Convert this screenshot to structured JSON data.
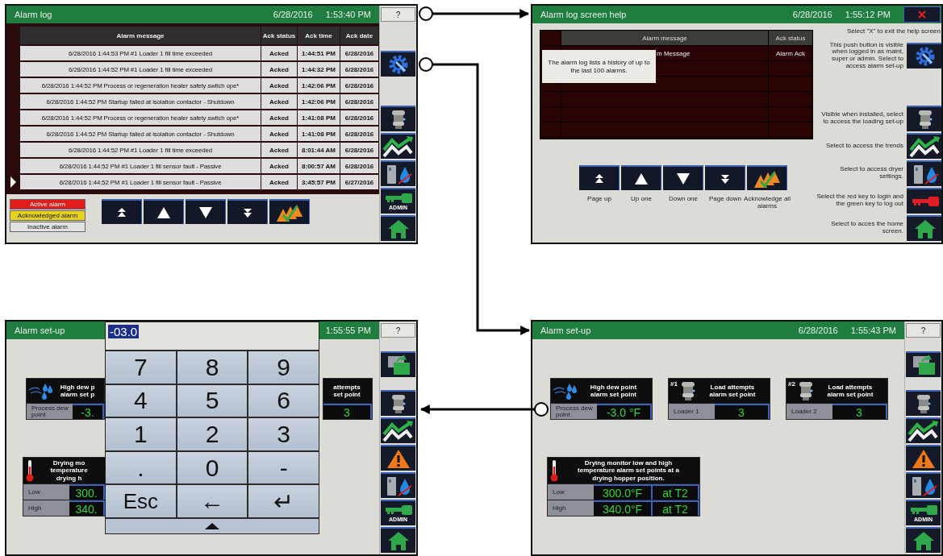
{
  "screens": [
    {
      "kind": "alarm_log",
      "title": "Alarm log",
      "date": "6/28/2016",
      "time": "1:53:40 PM",
      "help_button": "?",
      "table": {
        "columns": [
          "Alarm message",
          "Ack status",
          "Ack time",
          "Ack date"
        ],
        "rows": [
          {
            "cells": [
              "6/28/2016 1:44:53 PM #1 Loader 1 fill time exceeded",
              "Acked",
              "1:44:51 PM",
              "6/28/2016"
            ],
            "selected": false
          },
          {
            "cells": [
              "6/28/2016 1:44:52 PM #1 Loader 1 fill time exceeded",
              "Acked",
              "1:44:32 PM",
              "6/28/2016"
            ],
            "selected": false
          },
          {
            "cells": [
              "6/28/2016 1:44:52 PM Process or regeneration heater safety switch ope*",
              "Acked",
              "1:42:06 PM",
              "6/28/2016"
            ],
            "selected": false
          },
          {
            "cells": [
              "6/28/2016 1:44:52 PM Startup failed at isolation contactor - Shutdown",
              "Acked",
              "1:42:06 PM",
              "6/28/2016"
            ],
            "selected": false
          },
          {
            "cells": [
              "6/28/2016 1:44:52 PM Process or regeneration heater safety switch ope*",
              "Acked",
              "1:41:08 PM",
              "6/28/2016"
            ],
            "selected": false
          },
          {
            "cells": [
              "6/28/2016 1:44:52 PM Startup failed at isolation contactor - Shutdown",
              "Acked",
              "1:41:08 PM",
              "6/28/2016"
            ],
            "selected": false
          },
          {
            "cells": [
              "6/28/2016 1:44:52 PM #1 Loader 1 fill time exceeded",
              "Acked",
              "8:01:44 AM",
              "6/28/2016"
            ],
            "selected": false
          },
          {
            "cells": [
              "6/28/2016 1:44:52 PM #1 Loader 1 fill sensor fault - Passive",
              "Acked",
              "8:00:57 AM",
              "6/28/2016"
            ],
            "selected": false
          },
          {
            "cells": [
              "6/28/2016 1:44:52 PM #1 Loader 1 fill sensor fault - Passive",
              "Acked",
              "3:45:57 PM",
              "6/27/2016"
            ],
            "selected": true
          }
        ]
      },
      "legend": [
        {
          "label": "Active alarm",
          "color": "#e01c1c"
        },
        {
          "label": "Acknowledged alarm",
          "color": "#e6d21c"
        },
        {
          "label": "Inactive alarm",
          "color": "#e2e2e0"
        }
      ],
      "nav_buttons": [
        {
          "kind": "page_up"
        },
        {
          "kind": "up"
        },
        {
          "kind": "down"
        },
        {
          "kind": "page_down"
        },
        {
          "kind": "acknowledge"
        }
      ],
      "sidebar_top": [
        {
          "kind": "gear"
        }
      ],
      "sidebar": [
        {
          "kind": "loader"
        },
        {
          "kind": "trend"
        },
        {
          "kind": "dryer"
        },
        {
          "kind": "green_key",
          "label": "ADMIN"
        },
        {
          "kind": "home"
        }
      ]
    },
    {
      "kind": "help",
      "title": "Alarm log screen help",
      "date": "6/28/2016",
      "time": "1:55:12 PM",
      "table": {
        "columns": [
          "Alarm message",
          "Ack status"
        ],
        "rows": [
          {
            "cells": [
              "m Message",
              "Alarm Ack"
            ]
          }
        ]
      },
      "tooltip": "The alarm log lists a history of up to the last 100 alarms.",
      "nav_buttons": [
        {
          "kind": "page_up",
          "caption": "Page up"
        },
        {
          "kind": "up",
          "caption": "Up one"
        },
        {
          "kind": "down",
          "caption": "Down one"
        },
        {
          "kind": "page_down",
          "caption": "Page down"
        },
        {
          "kind": "acknowledge",
          "caption": "Acknowledge all alarms"
        }
      ],
      "close_hint": "Select \"X\" to exit the help screen",
      "help_items": [
        {
          "kind": "gear",
          "text": "This push button is visible when logged in as maint, super or admin. Select to access alarm set-up"
        },
        {
          "kind": "loader",
          "text": "Visible when installed, select to access the loading set-up"
        },
        {
          "kind": "trend",
          "text": "Select to access the trends"
        },
        {
          "kind": "dryer",
          "text": "Select to access dryer settings."
        },
        {
          "kind": "red_key",
          "text": "Select the red key to login and the green key to log out"
        },
        {
          "kind": "home",
          "text": "Select to acces the home screen."
        }
      ]
    },
    {
      "kind": "setup_keypad",
      "title": "Alarm set-up",
      "time": "1:55:55 PM",
      "help_button": "?",
      "cards": [
        {
          "kind": "dew",
          "title_lines": [
            "High dew p",
            "alarm set p"
          ],
          "rows": [
            {
              "label": "Process dew point",
              "value": "-3."
            }
          ]
        },
        {
          "title_lines": [
            "attempts",
            "set point"
          ],
          "rows": [
            {
              "value": "3"
            }
          ]
        }
      ],
      "drying_card": {
        "kind": "thermo",
        "title_lines": [
          "Drying mo",
          "temperature",
          "drying h"
        ],
        "rows": [
          {
            "label": "Low",
            "value": "300."
          },
          {
            "label": "High",
            "value": "340."
          }
        ]
      },
      "keypad": {
        "value": "-03.0",
        "keys": [
          "7",
          "8",
          "9",
          "4",
          "5",
          "6",
          "1",
          "2",
          "3",
          ".",
          "0",
          "-",
          "Esc",
          "←",
          "↵"
        ]
      },
      "sidebar_top": [
        {
          "kind": "swap"
        }
      ],
      "sidebar": [
        {
          "kind": "loader"
        },
        {
          "kind": "trend"
        },
        {
          "kind": "warning"
        },
        {
          "kind": "dryer"
        },
        {
          "kind": "green_key",
          "label": "ADMIN"
        },
        {
          "kind": "home"
        }
      ]
    },
    {
      "kind": "setup",
      "title": "Alarm set-up",
      "date": "6/28/2016",
      "time": "1:55:43 PM",
      "help_button": "?",
      "cards": [
        {
          "kind": "dew",
          "title_lines": [
            "High dew point",
            "alarm set point"
          ],
          "rows": [
            {
              "label": "Process dew point",
              "value": "-3.0 °F"
            }
          ]
        },
        {
          "kind": "loader",
          "tag": "#1",
          "title_lines": [
            "Load attempts",
            "alarm set point"
          ],
          "rows": [
            {
              "label": "Loader 1",
              "value": "3"
            }
          ]
        },
        {
          "kind": "loader",
          "tag": "#2",
          "title_lines": [
            "Load attempts",
            "alarm set point"
          ],
          "rows": [
            {
              "label": "Loader 2",
              "value": "3"
            }
          ]
        }
      ],
      "drying_card": {
        "kind": "thermo",
        "title_lines": [
          "Drying monitor low and high",
          "temperature alarm set points at a",
          "drying hopper position."
        ],
        "rows": [
          {
            "label": "Low",
            "value": "300.0°F",
            "position": "at T2"
          },
          {
            "label": "High",
            "value": "340.0°F",
            "position": "at T2"
          }
        ]
      },
      "sidebar_top": [
        {
          "kind": "swap"
        }
      ],
      "sidebar": [
        {
          "kind": "loader"
        },
        {
          "kind": "trend"
        },
        {
          "kind": "warning"
        },
        {
          "kind": "dryer"
        },
        {
          "kind": "green_key",
          "label": "ADMIN"
        },
        {
          "kind": "home"
        }
      ]
    }
  ]
}
